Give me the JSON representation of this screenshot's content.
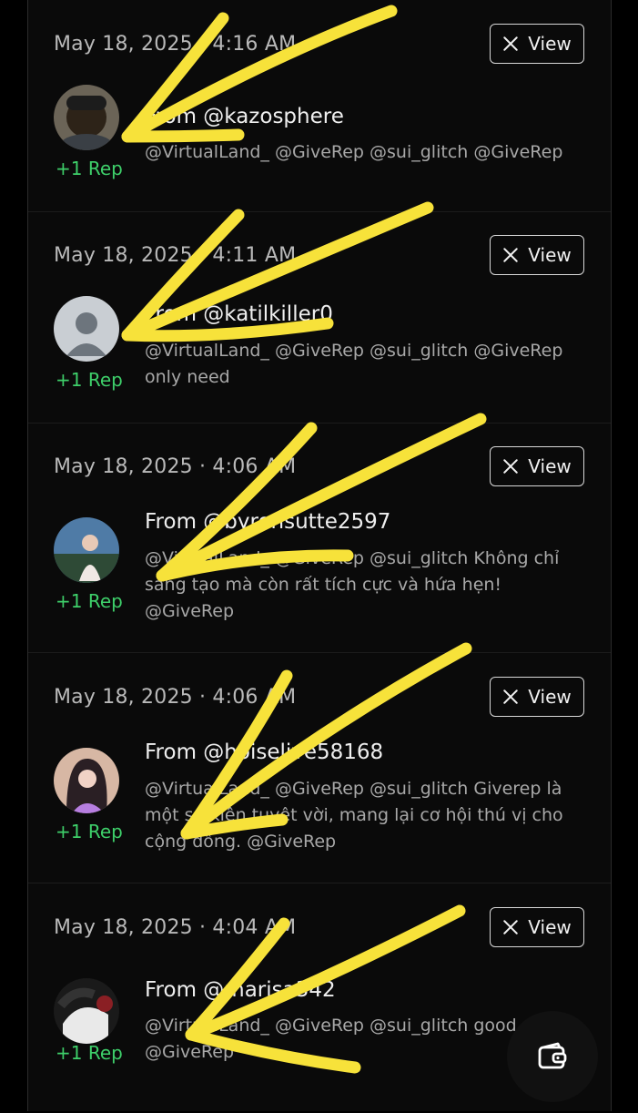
{
  "colors": {
    "background": "#0a0a0a",
    "rep_green": "#3ecf6a",
    "highlight_yellow": "#f7e23a"
  },
  "feed": [
    {
      "date": "May 18, 2025 · 4:16 AM",
      "view_label": "View",
      "rep_label": "+1 Rep",
      "from": "From @kazosphere",
      "text": "@VirtualLand_ @GiveRep @sui_glitch @GiveRep",
      "avatar": "photo-avatar-man"
    },
    {
      "date": "May 18, 2025 · 4:11 AM",
      "view_label": "View",
      "rep_label": "+1 Rep",
      "from": "From @katilkiller0",
      "text": "@VirtualLand_ @GiveRep @sui_glitch @GiveRep only need",
      "avatar": "default-user-avatar"
    },
    {
      "date": "May 18, 2025 · 4:06 AM",
      "view_label": "View",
      "rep_label": "+1 Rep",
      "from": "From @byronsutte2597",
      "text": "@VirtualLand_ @GiveRep @sui_glitch Không chỉ sáng tạo mà còn rất tích cực và hứa hẹn! @GiveRep",
      "avatar": "photo-avatar-woman-outdoor"
    },
    {
      "date": "May 18, 2025 · 4:06 AM",
      "view_label": "View",
      "rep_label": "+1 Rep",
      "from": "From @hoiselive58168",
      "text": "@VirtualLand_ @GiveRep @sui_glitch Giverep là một sự kiện tuyệt vời, mang lại cơ hội thú vị cho cộng đồng. @GiveRep",
      "avatar": "photo-avatar-woman-pink"
    },
    {
      "date": "May 18, 2025 · 4:04 AM",
      "view_label": "View",
      "rep_label": "+1 Rep",
      "from": "From @marisa342",
      "text": "@VirtualLand_ @GiveRep @sui_glitch good @GiveRep",
      "avatar": "photo-avatar-dark"
    }
  ],
  "wallet_button": {
    "icon": "wallet-icon"
  }
}
